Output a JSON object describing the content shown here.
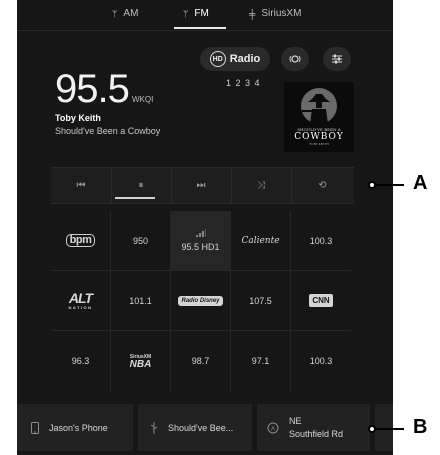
{
  "tabs": [
    {
      "label": "AM",
      "icon": "antenna-icon"
    },
    {
      "label": "FM",
      "icon": "antenna-icon",
      "active": true
    },
    {
      "label": "SiriusXM",
      "icon": "satellite-icon"
    }
  ],
  "now_playing": {
    "frequency": "95.5",
    "call_sign": "WKQI",
    "artist": "Toby Keith",
    "song": "Should've Been a Cowboy",
    "hd_label": "Radio",
    "hd_badge": "HD",
    "subchannels": "1 2 3 4",
    "album_art_text_1": "SHOULD'VE BEEN A",
    "album_art_text_2": "COWBOY",
    "album_art_text_3": "TOBY KEITH"
  },
  "transport": {
    "buttons": [
      {
        "name": "previous-button",
        "glyph": "⏮"
      },
      {
        "name": "pause-button",
        "glyph": "⏸",
        "active": true
      },
      {
        "name": "next-button",
        "glyph": "⏭"
      },
      {
        "name": "shuffle-button",
        "glyph": "⤨"
      },
      {
        "name": "repeat-button",
        "glyph": "⟲"
      }
    ]
  },
  "presets": {
    "row1": {
      "c1": "bpm",
      "c2": "950",
      "c3": "95.5 HD1",
      "c4": "Caliente",
      "c5": "100.3"
    },
    "row2": {
      "c1_big": "ALT",
      "c1_small": "NATION",
      "c2": "101.1",
      "c3": "Radio Disney",
      "c4": "107.5",
      "c5": "CNN"
    },
    "row3": {
      "c1": "96.3",
      "c2_top": "SiriusXM",
      "c2_bottom": "NBA",
      "c3": "98.7",
      "c4": "97.1",
      "c5": "100.3"
    }
  },
  "bottom": {
    "phone": "Jason's Phone",
    "media": "Should've Bee...",
    "nav_line1": "NE",
    "nav_line2": "Southfield Rd"
  },
  "callouts": {
    "a": "A",
    "b": "B"
  },
  "colors": {
    "background": "#161616",
    "text": "#d8d8d8",
    "accent": "#ffffff"
  }
}
